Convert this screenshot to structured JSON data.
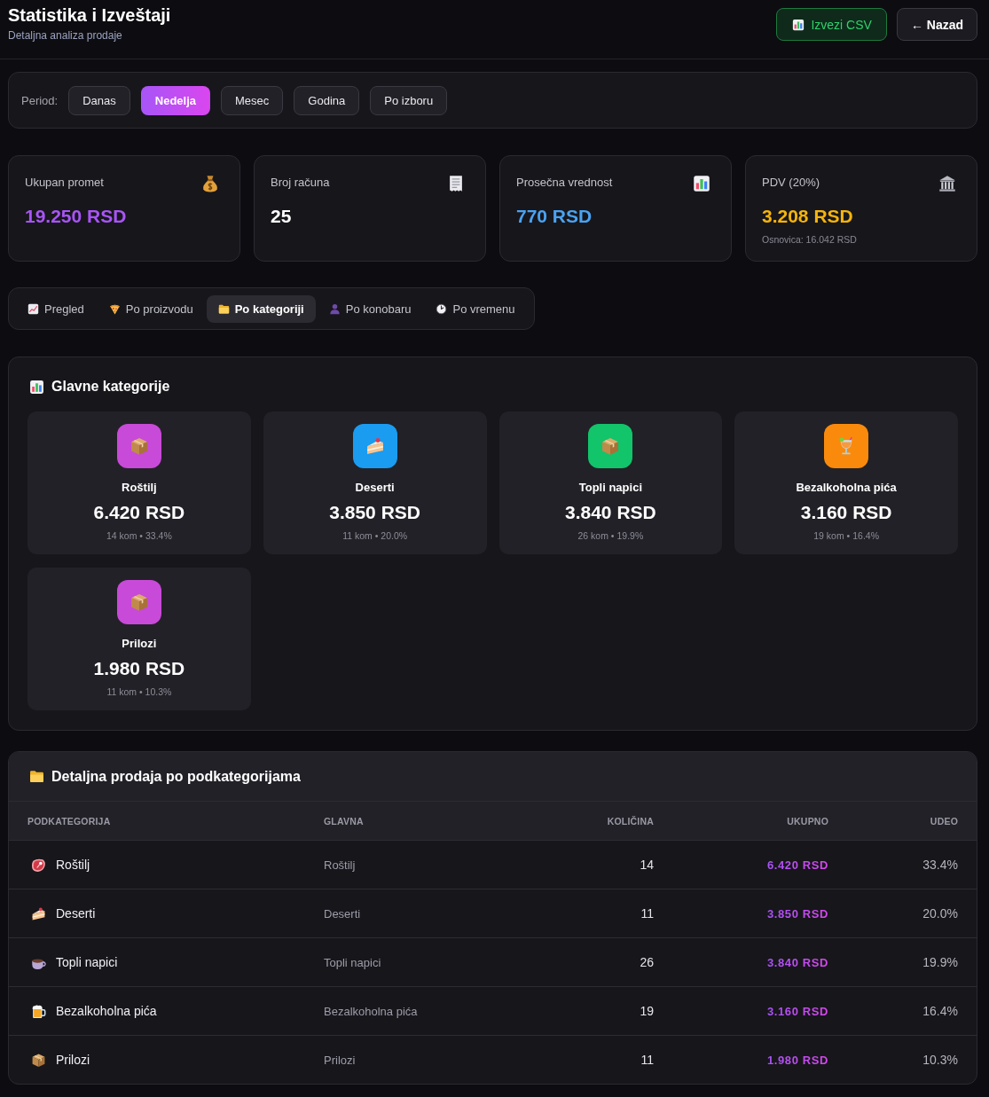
{
  "header": {
    "title": "Statistika i Izveštaji",
    "subtitle": "Detaljna analiza prodaje",
    "buttons": [
      {
        "label": "Izvezi CSV",
        "kind": "export"
      },
      {
        "label": "← Nazad",
        "kind": "back"
      }
    ]
  },
  "period": {
    "label": "Period:",
    "options": [
      {
        "label": "Danas",
        "selected": false
      },
      {
        "label": "Nedelja",
        "selected": true
      },
      {
        "label": "Mesec",
        "selected": false
      },
      {
        "label": "Godina",
        "selected": false
      },
      {
        "label": "Po izboru",
        "selected": false
      }
    ]
  },
  "stats": [
    {
      "label": "Ukupan promet",
      "value": "19.250 RSD",
      "color": "#a855f7",
      "kind": "money"
    },
    {
      "label": "Broj računa",
      "value": "25",
      "color": "#ffffff",
      "kind": "receipt"
    },
    {
      "label": "Prosečna vrednost",
      "value": "770 RSD",
      "color": "#4aa3f2",
      "kind": "chart"
    },
    {
      "label": "PDV (20%)",
      "value": "3.208 RSD",
      "color": "#f5b40b",
      "kind": "bank",
      "note": "Osnovica: 16.042 RSD"
    }
  ],
  "tabs": [
    {
      "label": "Pregled",
      "selected": false,
      "kind": "trend"
    },
    {
      "label": "Po proizvodu",
      "selected": false,
      "kind": "pizza"
    },
    {
      "label": "Po kategoriji",
      "selected": true,
      "kind": "folder"
    },
    {
      "label": "Po konobaru",
      "selected": false,
      "kind": "person"
    },
    {
      "label": "Po vremenu",
      "selected": false,
      "kind": "clock"
    }
  ],
  "categories": {
    "title": "Glavne kategorije",
    "items": [
      {
        "name": "Roštilj",
        "value": "6.420 RSD",
        "details": "14 kom • 33.4%",
        "kind": "box",
        "color": "#c84ad8"
      },
      {
        "name": "Deserti",
        "value": "3.850 RSD",
        "details": "11 kom • 20.0%",
        "kind": "cake",
        "color": "#1a9cf0"
      },
      {
        "name": "Topli napici",
        "value": "3.840 RSD",
        "details": "26 kom • 19.9%",
        "kind": "box",
        "color": "#12c46a"
      },
      {
        "name": "Bezalkoholna pića",
        "value": "3.160 RSD",
        "details": "19 kom • 16.4%",
        "kind": "cocktail",
        "color": "#fa8a0c"
      },
      {
        "name": "Prilozi",
        "value": "1.980 RSD",
        "details": "11 kom • 10.3%",
        "kind": "box",
        "color": "#c84ad8"
      }
    ]
  },
  "subcategories": {
    "title": "Detaljna prodaja po podkategorijama",
    "columns": [
      "PODKATEGORIJA",
      "GLAVNA",
      "KOLIČINA",
      "UKUPNO",
      "UDEO"
    ],
    "rows": [
      {
        "name": "Roštilj",
        "kind": "meat",
        "category": "Roštilj",
        "quantity": "14",
        "total": "6.420 RSD",
        "share": "33.4%"
      },
      {
        "name": "Deserti",
        "kind": "cake",
        "category": "Deserti",
        "quantity": "11",
        "total": "3.850 RSD",
        "share": "20.0%"
      },
      {
        "name": "Topli napici",
        "kind": "coffee",
        "category": "Topli napici",
        "quantity": "26",
        "total": "3.840 RSD",
        "share": "19.9%"
      },
      {
        "name": "Bezalkoholna pića",
        "kind": "beer",
        "category": "Bezalkoholna pića",
        "quantity": "19",
        "total": "3.160 RSD",
        "share": "16.4%"
      },
      {
        "name": "Prilozi",
        "kind": "box",
        "category": "Prilozi",
        "quantity": "11",
        "total": "1.980 RSD",
        "share": "10.3%"
      }
    ]
  }
}
